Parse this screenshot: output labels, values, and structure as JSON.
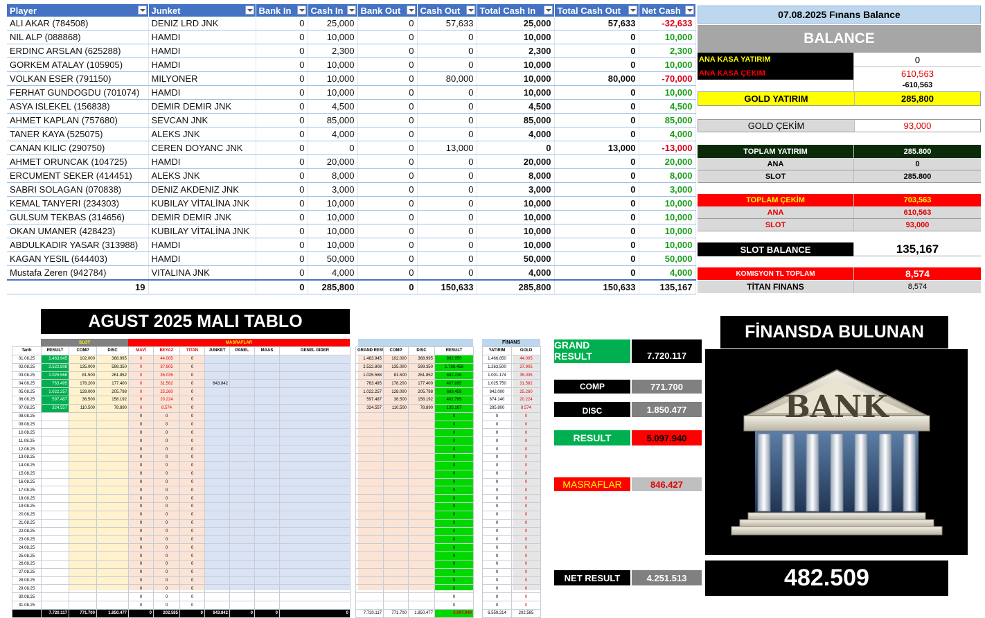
{
  "players": {
    "columns": [
      "Player",
      "Junket",
      "Bank In",
      "Cash In",
      "Bank Out",
      "Cash Out",
      "Total Cash In",
      "Total Cash Out",
      "Net Cash"
    ],
    "rows": [
      [
        "ALI AKAR (784508)",
        "DENIZ LRD JNK",
        "0",
        "25,000",
        "0",
        "57,633",
        "25,000",
        "57,633",
        "-32,633"
      ],
      [
        "NIL ALP (088868)",
        "HAMDI",
        "0",
        "10,000",
        "0",
        "0",
        "10,000",
        "0",
        "10,000"
      ],
      [
        "ERDINC ARSLAN (625288)",
        "HAMDI",
        "0",
        "2,300",
        "0",
        "0",
        "2,300",
        "0",
        "2,300"
      ],
      [
        "GORKEM ATALAY (105905)",
        "HAMDI",
        "0",
        "10,000",
        "0",
        "0",
        "10,000",
        "0",
        "10,000"
      ],
      [
        "VOLKAN ESER (791150)",
        "MILYONER",
        "0",
        "10,000",
        "0",
        "80,000",
        "10,000",
        "80,000",
        "-70,000"
      ],
      [
        "FERHAT GUNDOGDU (701074)",
        "HAMDI",
        "0",
        "10,000",
        "0",
        "0",
        "10,000",
        "0",
        "10,000"
      ],
      [
        "ASYA ISLEKEL (156838)",
        "DEMIR DEMIR JNK",
        "0",
        "4,500",
        "0",
        "0",
        "4,500",
        "0",
        "4,500"
      ],
      [
        "AHMET KAPLAN (757680)",
        "SEVCAN JNK",
        "0",
        "85,000",
        "0",
        "0",
        "85,000",
        "0",
        "85,000"
      ],
      [
        "TANER KAYA (525075)",
        "ALEKS JNK",
        "0",
        "4,000",
        "0",
        "0",
        "4,000",
        "0",
        "4,000"
      ],
      [
        "CANAN KILIC (290750)",
        "CEREN DOYANC JNK",
        "0",
        "0",
        "0",
        "13,000",
        "0",
        "13,000",
        "-13,000"
      ],
      [
        "AHMET ORUNCAK (104725)",
        "HAMDI",
        "0",
        "20,000",
        "0",
        "0",
        "20,000",
        "0",
        "20,000"
      ],
      [
        "ERCUMENT SEKER (414451)",
        "ALEKS JNK",
        "0",
        "8,000",
        "0",
        "0",
        "8,000",
        "0",
        "8,000"
      ],
      [
        "SABRI SOLAGAN (070838)",
        "DENIZ  AKDENIZ JNK",
        "0",
        "3,000",
        "0",
        "0",
        "3,000",
        "0",
        "3,000"
      ],
      [
        "KEMAL TANYERI (234303)",
        "KUBILAY VİTALİNA JNK",
        "0",
        "10,000",
        "0",
        "0",
        "10,000",
        "0",
        "10,000"
      ],
      [
        "GULSUM TEKBAS (314656)",
        "DEMIR DEMIR JNK",
        "0",
        "10,000",
        "0",
        "0",
        "10,000",
        "0",
        "10,000"
      ],
      [
        "OKAN UMANER (428423)",
        "KUBILAY VİTALİNA JNK",
        "0",
        "10,000",
        "0",
        "0",
        "10,000",
        "0",
        "10,000"
      ],
      [
        "ABDULKADIR YASAR (313988)",
        "HAMDI",
        "0",
        "10,000",
        "0",
        "0",
        "10,000",
        "0",
        "10,000"
      ],
      [
        "KAGAN YESIL (644403)",
        "HAMDI",
        "0",
        "50,000",
        "0",
        "0",
        "50,000",
        "0",
        "50,000"
      ],
      [
        "Mustafa Zeren (942784)",
        "VITALINA JNK",
        "0",
        "4,000",
        "0",
        "0",
        "4,000",
        "0",
        "4,000"
      ]
    ],
    "total": [
      "19",
      "",
      "0",
      "285,800",
      "0",
      "150,633",
      "285,800",
      "150,633",
      "135,167"
    ]
  },
  "balance": {
    "title": "07.08.2025  Fınans  Balance",
    "header": "BALANCE",
    "ana_kasa_yatirim_label": "ANA KASA YATIRIM",
    "ana_kasa_yatirim_value": "0",
    "ana_kasa_cekim_label": "ANA KASA ÇEKIM",
    "ana_kasa_cekim_value": "610,563",
    "ana_kasa_diff": "-610,563",
    "gold_yatirim_label": "GOLD YATIRIM",
    "gold_yatirim_value": "285,800",
    "gold_cekim_label": "GOLD  ÇEKİM",
    "gold_cekim_value": "93,000",
    "toplam_yatirim_label": "TOPLAM YATIRIM",
    "toplam_yatirim_value": "285.800",
    "ty_ana_label": "ANA",
    "ty_ana_value": "0",
    "ty_slot_label": "SLOT",
    "ty_slot_value": "285.800",
    "toplam_cekim_label": "TOPLAM ÇEKİM",
    "toplam_cekim_value": "703,563",
    "tc_ana_label": "ANA",
    "tc_ana_value": "610,563",
    "tc_slot_label": "SLOT",
    "tc_slot_value": "93,000",
    "slot_balance_label": "SLOT BALANCE",
    "slot_balance_value": "135,167",
    "komisyon_label": "KOMISYON TL TOPLAM",
    "komisyon_value": "8,574",
    "titan_label": "TİTAN FINANS",
    "titan_value": "8,574",
    "colors": {
      "yellow": "#ffff00",
      "red": "#ff0000",
      "dark_green": "#0a2a0a",
      "grey": "#a6a6a6",
      "black": "#000000"
    }
  },
  "mali": {
    "title": "AGUST 2025 MALI TABLO",
    "group_slot": "SLOT",
    "group_masraflar": "MASRAFLAR",
    "headers": [
      "Tarih",
      "RESULT",
      "COMP",
      "DISC",
      "MAVİ",
      "BEYAZ",
      "TITAN",
      "JUNKET",
      "PANEL",
      "MAAS",
      "GENEL GIDER"
    ],
    "rows": [
      [
        "01.08.25",
        "1.463.945",
        "102.000",
        "368.995",
        "0",
        "44.005",
        "0",
        "",
        "",
        "",
        ""
      ],
      [
        "02.08.25",
        "2.522.808",
        "135.000",
        "599.350",
        "0",
        "37.905",
        "0",
        "",
        "",
        "",
        ""
      ],
      [
        "03.08.25",
        "1.025.568",
        "81.500",
        "261.852",
        "0",
        "35.035",
        "0",
        "",
        "",
        "",
        ""
      ],
      [
        "04.08.25",
        "763.495",
        "178.200",
        "177.400",
        "0",
        "31.582",
        "0",
        "643.842",
        "",
        "",
        ""
      ],
      [
        "05.08.25",
        "1.022.257",
        "128.000",
        "205.798",
        "0",
        "25.260",
        "0",
        "",
        "",
        "",
        ""
      ],
      [
        "06.08.25",
        "597.487",
        "36.500",
        "158.192",
        "0",
        "20.224",
        "0",
        "",
        "",
        "",
        ""
      ],
      [
        "07.08.25",
        "324.557",
        "110.500",
        "78.890",
        "0",
        "8.574",
        "0",
        "",
        "",
        "",
        ""
      ],
      [
        "08.08.25",
        "",
        "",
        "",
        "0",
        "0",
        "0",
        "",
        "",
        "",
        ""
      ],
      [
        "09.08.25",
        "",
        "",
        "",
        "0",
        "0",
        "0",
        "",
        "",
        "",
        ""
      ],
      [
        "10.08.25",
        "",
        "",
        "",
        "0",
        "0",
        "0",
        "",
        "",
        "",
        ""
      ],
      [
        "11.08.25",
        "",
        "",
        "",
        "0",
        "0",
        "0",
        "",
        "",
        "",
        ""
      ],
      [
        "12.08.25",
        "",
        "",
        "",
        "0",
        "0",
        "0",
        "",
        "",
        "",
        ""
      ],
      [
        "13.08.25",
        "",
        "",
        "",
        "0",
        "0",
        "0",
        "",
        "",
        "",
        ""
      ],
      [
        "14.08.25",
        "",
        "",
        "",
        "0",
        "0",
        "0",
        "",
        "",
        "",
        ""
      ],
      [
        "15.08.25",
        "",
        "",
        "",
        "0",
        "0",
        "0",
        "",
        "",
        "",
        ""
      ],
      [
        "16.08.25",
        "",
        "",
        "",
        "0",
        "0",
        "0",
        "",
        "",
        "",
        ""
      ],
      [
        "17.08.25",
        "",
        "",
        "",
        "0",
        "0",
        "0",
        "",
        "",
        "",
        ""
      ],
      [
        "18.08.25",
        "",
        "",
        "",
        "0",
        "0",
        "0",
        "",
        "",
        "",
        ""
      ],
      [
        "19.08.25",
        "",
        "",
        "",
        "0",
        "0",
        "0",
        "",
        "",
        "",
        ""
      ],
      [
        "20.08.25",
        "",
        "",
        "",
        "0",
        "0",
        "0",
        "",
        "",
        "",
        ""
      ],
      [
        "21.08.25",
        "",
        "",
        "",
        "0",
        "0",
        "0",
        "",
        "",
        "",
        ""
      ],
      [
        "22.08.25",
        "",
        "",
        "",
        "0",
        "0",
        "0",
        "",
        "",
        "",
        ""
      ],
      [
        "23.08.25",
        "",
        "",
        "",
        "0",
        "0",
        "0",
        "",
        "",
        "",
        ""
      ],
      [
        "24.08.25",
        "",
        "",
        "",
        "0",
        "0",
        "0",
        "",
        "",
        "",
        ""
      ],
      [
        "25.08.25",
        "",
        "",
        "",
        "0",
        "0",
        "0",
        "",
        "",
        "",
        ""
      ],
      [
        "26.08.25",
        "",
        "",
        "",
        "0",
        "0",
        "0",
        "",
        "",
        "",
        ""
      ],
      [
        "27.08.25",
        "",
        "",
        "",
        "0",
        "0",
        "0",
        "",
        "",
        "",
        ""
      ],
      [
        "28.08.25",
        "",
        "",
        "",
        "0",
        "0",
        "0",
        "",
        "",
        "",
        ""
      ],
      [
        "29.08.25",
        "",
        "",
        "",
        "0",
        "0",
        "0",
        "",
        "",
        "",
        ""
      ],
      [
        "30.08.25",
        "",
        "",
        "",
        "0",
        "0",
        "0",
        "",
        "",
        "",
        ""
      ],
      [
        "31.08.25",
        "",
        "",
        "",
        "0",
        "0",
        "0",
        "",
        "",
        "",
        ""
      ]
    ],
    "total": [
      "",
      "7.720.117",
      "771.700",
      "1.850.477",
      "0",
      "202.585",
      "0",
      "643.842",
      "0",
      "0",
      "0",
      "0",
      "0"
    ]
  },
  "grand": {
    "headers": [
      "GRAND RESULT",
      "COMP",
      "DISC",
      "RESULT"
    ],
    "rows": [
      [
        "1.463.945",
        "102.000",
        "368.995",
        "992.950"
      ],
      [
        "2.522.808",
        "135.000",
        "599.350",
        "1.788.458"
      ],
      [
        "1.025.568",
        "81.500",
        "261.852",
        "682.216"
      ],
      [
        "763.495",
        "178.200",
        "177.400",
        "407.895"
      ],
      [
        "1.022.257",
        "128.000",
        "205.798",
        "688.459"
      ],
      [
        "597.487",
        "36.500",
        "158.192",
        "402.795"
      ],
      [
        "324.557",
        "110.500",
        "78.890",
        "135.167"
      ]
    ],
    "empty_result": "0",
    "total": [
      "7.720.117",
      "771.700",
      "1.850.477",
      "5.097.940"
    ]
  },
  "finans": {
    "title": "FİNANS",
    "headers": [
      "YATIRIM",
      "GOLD"
    ],
    "rows": [
      [
        "1.466.850",
        "44.005"
      ],
      [
        "1.263.500",
        "37.905"
      ],
      [
        "1.001.174",
        "35.035"
      ],
      [
        "1.025.750",
        "31.582"
      ],
      [
        "842.000",
        "25.260"
      ],
      [
        "674.140",
        "20.224"
      ],
      [
        "285.800",
        "8.574"
      ]
    ],
    "empty": "0",
    "total": [
      "6.559.214",
      "202.585"
    ]
  },
  "summary": {
    "grand_result_label": "GRAND RESULT",
    "grand_result_value": "7.720.117",
    "comp_label": "COMP",
    "comp_value": "771.700",
    "disc_label": "DISC",
    "disc_value": "1.850.477",
    "result_label": "RESULT",
    "result_value": "5.097.940",
    "masraflar_label": "MASRAFLAR",
    "masraflar_value": "846.427",
    "net_result_label": "NET RESULT",
    "net_result_value": "4.251.513"
  },
  "finansda": {
    "title": "FİNANSDA BULUNAN",
    "bank_sign": "BANK",
    "amount": "482.509"
  }
}
